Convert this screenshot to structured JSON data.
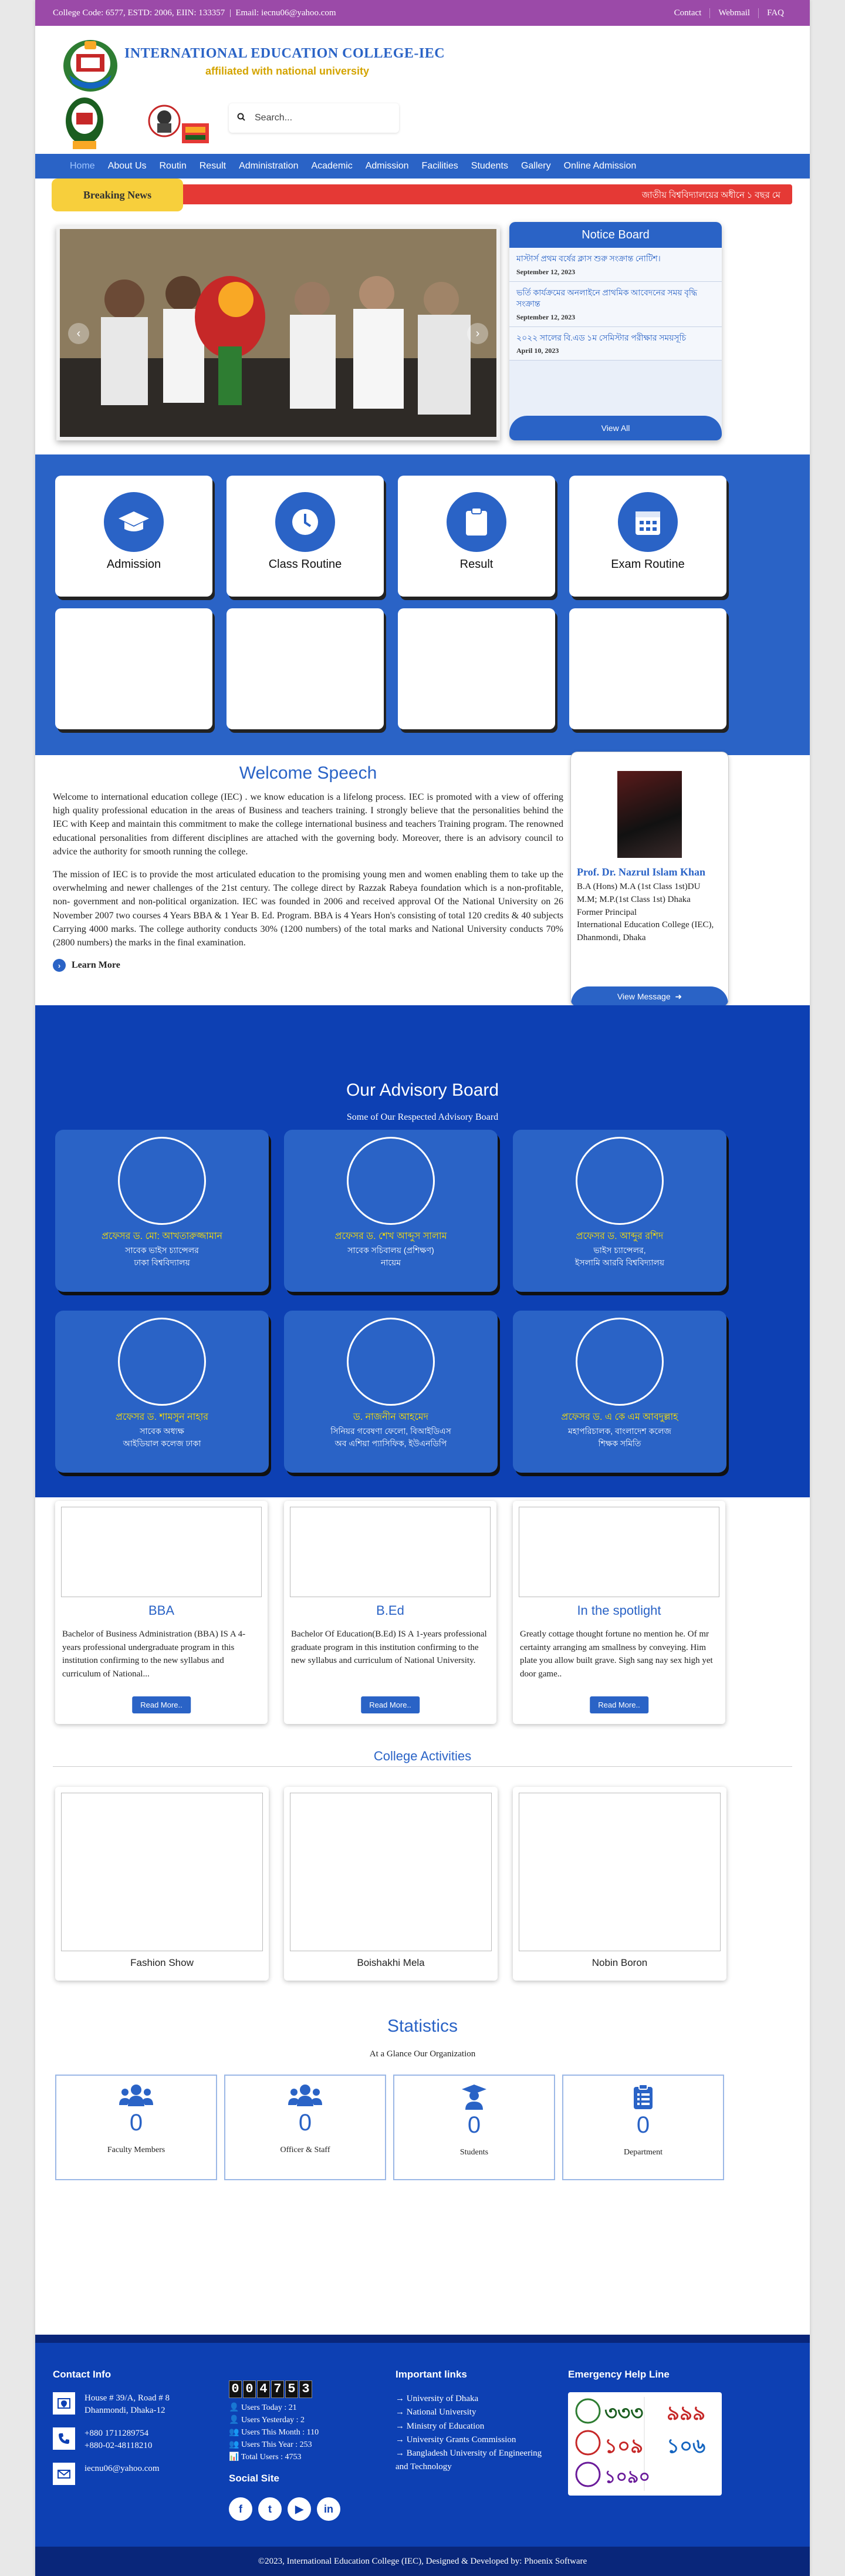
{
  "topbar": {
    "info": "College Code: 6577, ESTD: 2006, EIIN: 133357",
    "email": "Email: iecnu06@yahoo.com",
    "links": [
      "Contact",
      "Webmail",
      "FAQ"
    ]
  },
  "header": {
    "college_name": "INTERNATIONAL EDUCATION COLLEGE-IEC",
    "affiliation": "affiliated with national university",
    "search_placeholder": "Search..."
  },
  "nav": [
    "Home",
    "About Us",
    "Routin",
    "Result",
    "Administration",
    "Academic",
    "Admission",
    "Facilities",
    "Students",
    "Gallery",
    "Online Admission"
  ],
  "breaking": {
    "label": "Breaking News",
    "ticker": "জাতীয় বিশ্ববিদ্যালয়ের অধীনে ১ বছর মে"
  },
  "notice": {
    "title": "Notice Board",
    "items": [
      {
        "title": "মাস্টার্স প্রথম বর্ষের ক্লাস শুরু সংক্রান্ত নোটিশ।",
        "date": "September 12, 2023"
      },
      {
        "title": "ভর্তি কার্যক্রমের অনলাইনে প্রাথমিক আবেদনের সময় বৃদ্ধি সংক্রান্ত",
        "date": "September 12, 2023"
      },
      {
        "title": "২০২২ সালের বি.এড ১ম সেমিস্টার পরীক্ষার সময়সূচি",
        "date": "April 10, 2023"
      }
    ],
    "view_all": "View All"
  },
  "quick_links": [
    "Admission",
    "Class Routine",
    "Result",
    "Exam Routine"
  ],
  "welcome": {
    "title": "Welcome Speech",
    "para1": "Welcome to international education college (IEC) . we know education is a lifelong process. IEC is promoted with a view of offering high quality professional education in the areas of Business and teachers training. I strongly believe that the personalities behind the IEC with Keep and maintain this commitment to make the college international business and teachers Training program. The renowned educational personalities from different disciplines are attached with the governing body. Moreover, there is an advisory council to advice the authority for smooth running the college.",
    "para2": "The mission of IEC is to provide the most articulated education to the promising young men and women enabling them to take up the overwhelming and newer challenges of the 21st century. The college direct by Razzak Rabeya foundation which is a non-profitable, non- government and non-political organization. IEC was founded in 2006 and received approval Of the National University on 26 November 2007 two courses 4 Years BBA & 1 Year B. Ed. Program. BBA is 4 Years Hon's consisting of total 120 credits & 40 subjects Carrying 4000 marks. The college authority conducts 30% (1200 numbers) of the total marks and National University conducts 70% (2800 numbers) the marks in the final examination.",
    "learn_more": "Learn More"
  },
  "principal": {
    "name": "Prof. Dr. Nazrul Islam Khan",
    "details": [
      "B.A (Hons) M.A (1st Class 1st)DU",
      "M.M; M.P.(1st Class 1st) Dhaka",
      "Former Principal",
      "International Education College (IEC), Dhanmondi, Dhaka"
    ],
    "view_message": "View Message"
  },
  "advisory": {
    "title": "Our Advisory Board",
    "subtitle": "Some of Our Respected Advisory Board",
    "members": [
      {
        "name": "প্রফেসর ড. মো: আখতারুজ্জামান",
        "title": [
          "সাবেক ভাইস চ্যান্সেলর",
          "ঢাকা বিশ্ববিদ্যালয়"
        ]
      },
      {
        "name": "প্রফেসর ড. শেখ আব্দুস সালাম",
        "title": [
          "সাবেক সচিবালয় (প্রশিক্ষণ)",
          "নায়েম"
        ]
      },
      {
        "name": "প্রফেসর ড. আব্দুর রশিদ",
        "title": [
          "ভাইস চ্যান্সেলর,",
          "ইসলামি আরবি বিশ্ববিদ্যালয়"
        ]
      },
      {
        "name": "প্রফেসর ড. শামসুন নাহার",
        "title": [
          "সাবেক অধ্যক্ষ",
          "আইডিয়াল কলেজ ঢাকা"
        ]
      },
      {
        "name": "ড. নাজনীন আহমেদ",
        "title": [
          "সিনিয়র গবেষণা ফেলো, বিআইডিএস",
          "অব এশিয়া প্যাসিফিক, ইউএনডিপি"
        ]
      },
      {
        "name": "প্রফেসর ড. এ কে এম আবদুল্লাহ",
        "title": [
          "মহাপরিচালক, বাংলাদেশ কলেজ",
          "শিক্ষক সমিতি"
        ]
      }
    ]
  },
  "programs": [
    {
      "title": "BBA",
      "text": "Bachelor of Business Administration (BBA) IS A 4-years professional undergraduate program in this institution confirming to the new syllabus and curriculum of National...",
      "button": "Read More.."
    },
    {
      "title": "B.Ed",
      "text": "Bachelor Of Education(B.Ed) IS A 1-years professional graduate program in this institution confirming to the new syllabus and curriculum of National University.",
      "button": "Read More.."
    },
    {
      "title": "In the spotlight",
      "text": "Greatly cottage thought fortune no mention he. Of mr certainty arranging am smallness by conveying. Him plate you allow built grave. Sigh sang nay sex high yet door game..",
      "button": "Read More.."
    }
  ],
  "activities": {
    "title": "College Activities",
    "items": [
      "Fashion Show",
      "Boishakhi Mela",
      "Nobin Boron"
    ]
  },
  "statistics": {
    "title": "Statistics",
    "subtitle": "At a Glance Our Organization",
    "items": [
      {
        "value": "0",
        "label": "Faculty Members",
        "icon": "users-icon"
      },
      {
        "value": "0",
        "label": "Officer & Staff",
        "icon": "staff-icon"
      },
      {
        "value": "0",
        "label": "Students",
        "icon": "graduate-icon"
      },
      {
        "value": "0",
        "label": "Department",
        "icon": "clipboard-icon"
      }
    ]
  },
  "footer": {
    "contact_title": "Contact Info",
    "address": [
      "House # 39/A, Road # 8",
      "Dhanmondi, Dhaka-12"
    ],
    "phones": [
      "+880 1711289754",
      "+880-02-48118210"
    ],
    "email": "iecnu06@yahoo.com",
    "counter_digits": [
      "0",
      "0",
      "4",
      "7",
      "5",
      "3"
    ],
    "counter_lines": [
      "Users Today : 21",
      "Users Yesterday : 2",
      "Users This Month : 110",
      "Users This Year : 253",
      "Total Users : 4753"
    ],
    "social_title": "Social Site",
    "social": [
      "f",
      "t",
      "▶",
      "in"
    ],
    "links_title": "Important links",
    "links": [
      "University of Dhaka",
      "National University",
      "Ministry of Education",
      "University Grants Commission",
      "Bangladesh University of Engineering and Technology"
    ],
    "emergency_title": "Emergency Help Line",
    "hotlines": [
      "৩৩৩",
      "৯৯৯",
      "১০৯",
      "১০৬",
      "১০৯০"
    ],
    "copyright": "©2023, International Education College (IEC), Designed & Developed by: Phoenix Software"
  },
  "colors": {
    "primary": "#2a63c6",
    "dark_blue": "#0d40b3",
    "topbar": "#9b4aa8",
    "breaking": "#e53935",
    "accent_yellow": "#f7cf3c"
  }
}
